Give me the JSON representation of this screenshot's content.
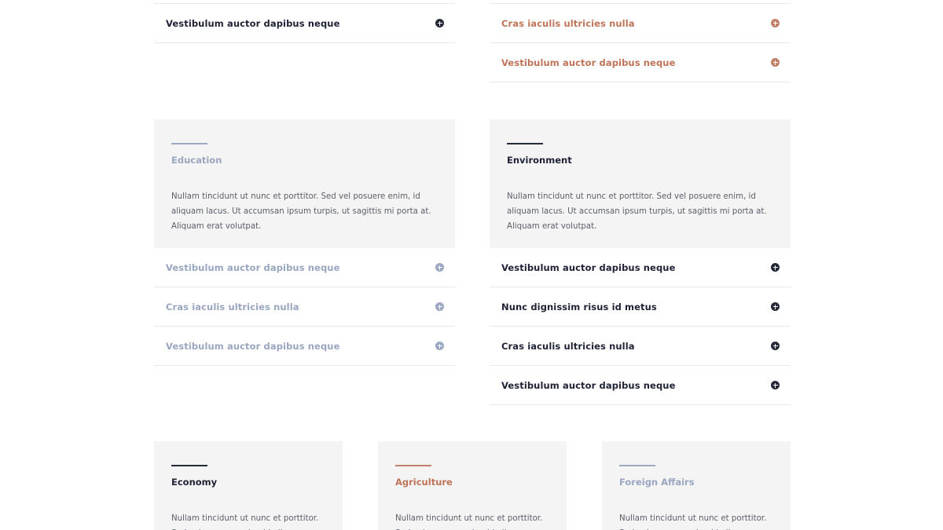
{
  "colors": {
    "dark": "#262938",
    "copper": "#c38068",
    "blue_gray": "#9ca8c1",
    "card_bg": "#f4f4f5",
    "divider": "#e8e8ea"
  },
  "top_left_list": {
    "items": [
      {
        "label": "Vestibulum auctor dapibus neque",
        "icon": "plus-circle-icon"
      }
    ]
  },
  "top_right_list": {
    "items": [
      {
        "label": "Cras iaculis ultricies nulla",
        "icon": "plus-circle-icon"
      },
      {
        "label": "Vestibulum auctor dapibus neque",
        "icon": "plus-circle-icon"
      }
    ]
  },
  "education": {
    "title": "Education",
    "body": "Nullam tincidunt ut nunc et porttitor. Sed vel posuere enim, id aliquam lacus. Ut accumsan ipsum turpis, ut sagittis mi porta at. Aliquam erat volutpat.",
    "items": [
      {
        "label": "Vestibulum auctor dapibus neque"
      },
      {
        "label": "Cras iaculis ultricies nulla"
      },
      {
        "label": "Vestibulum auctor dapibus neque"
      }
    ]
  },
  "environment": {
    "title": "Environment",
    "body": "Nullam tincidunt ut nunc et porttitor. Sed vel posuere enim, id aliquam lacus. Ut accumsan ipsum turpis, ut sagittis mi porta at. Aliquam erat volutpat.",
    "items": [
      {
        "label": "Vestibulum auctor dapibus neque"
      },
      {
        "label": "Nunc dignissim risus id metus"
      },
      {
        "label": "Cras iaculis ultricies nulla"
      },
      {
        "label": "Vestibulum auctor dapibus neque"
      }
    ]
  },
  "economy": {
    "title": "Economy",
    "body": "Nullam tincidunt ut nunc et porttitor. Sed vel posuere enim, id aliquam lacus."
  },
  "agriculture": {
    "title": "Agriculture",
    "body": "Nullam tincidunt ut nunc et porttitor. Sed vel posuere enim, id aliquam lacus."
  },
  "foreign_affairs": {
    "title": "Foreign Affairs",
    "body": "Nullam tincidunt ut nunc et porttitor. Sed vel posuere enim, id aliquam lacus."
  }
}
